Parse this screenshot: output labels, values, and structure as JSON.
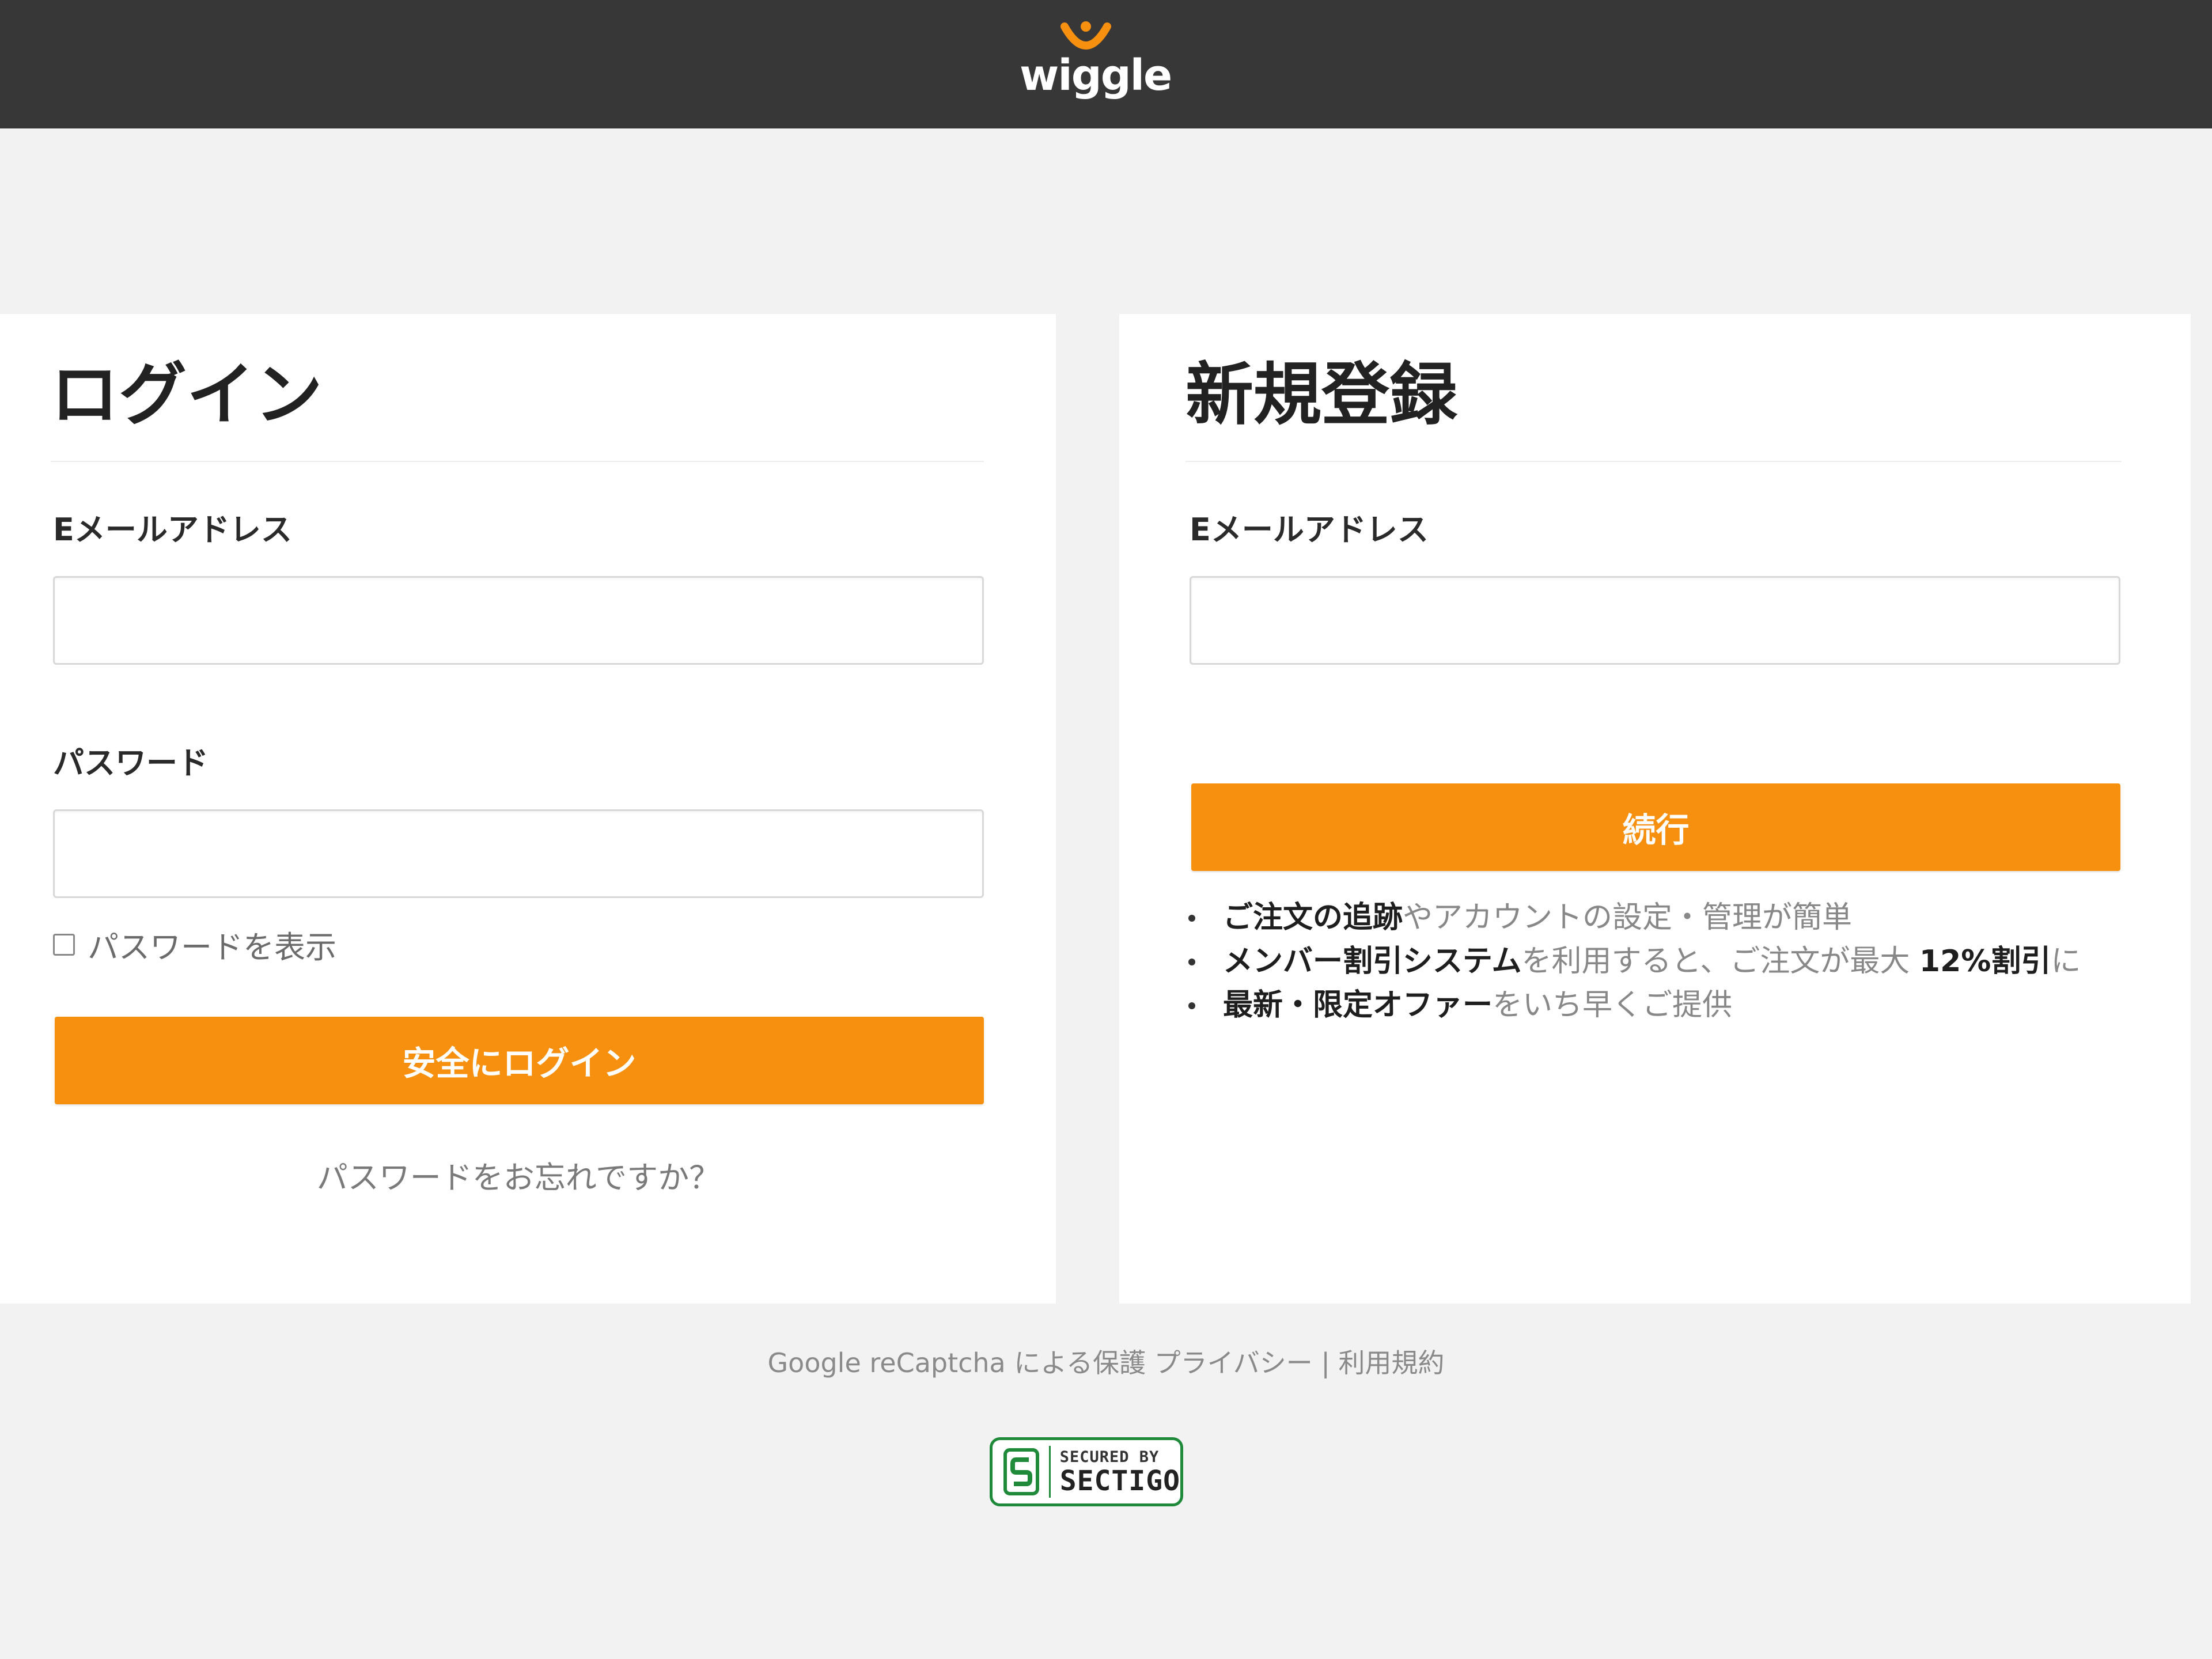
{
  "header": {
    "logo_text": "wiggle"
  },
  "login": {
    "title": "ログイン",
    "email_label": "Eメールアドレス",
    "email_value": "",
    "password_label": "パスワード",
    "password_value": "",
    "show_password_label": "パスワードを表示",
    "submit_label": "安全にログイン",
    "forgot_password": "パスワードをお忘れですか？"
  },
  "register": {
    "title": "新規登録",
    "email_label": "Eメールアドレス",
    "email_value": "",
    "continue_label": "続行",
    "benefits": [
      {
        "strong": "ご注文の追跡",
        "text": "やアカウントの設定・管理が簡単",
        "strong2": "",
        "text2": ""
      },
      {
        "strong": "メンバー割引システム",
        "text": "を利用すると、ご注文が最大 ",
        "strong2": "12%割引",
        "text2": "に"
      },
      {
        "strong": "最新・限定オファー",
        "text": "をいち早くご提供",
        "strong2": "",
        "text2": ""
      }
    ]
  },
  "footer": {
    "recaptcha_text": "Google reCaptcha による保護",
    "privacy_link": "プライバシー",
    "separator": "|",
    "terms_link": "利用規約",
    "badge_small": "SECURED BY",
    "badge_big": "SECTIGO"
  },
  "colors": {
    "accent": "#f7900f",
    "topbar": "#373737",
    "background": "#f2f2f2"
  }
}
